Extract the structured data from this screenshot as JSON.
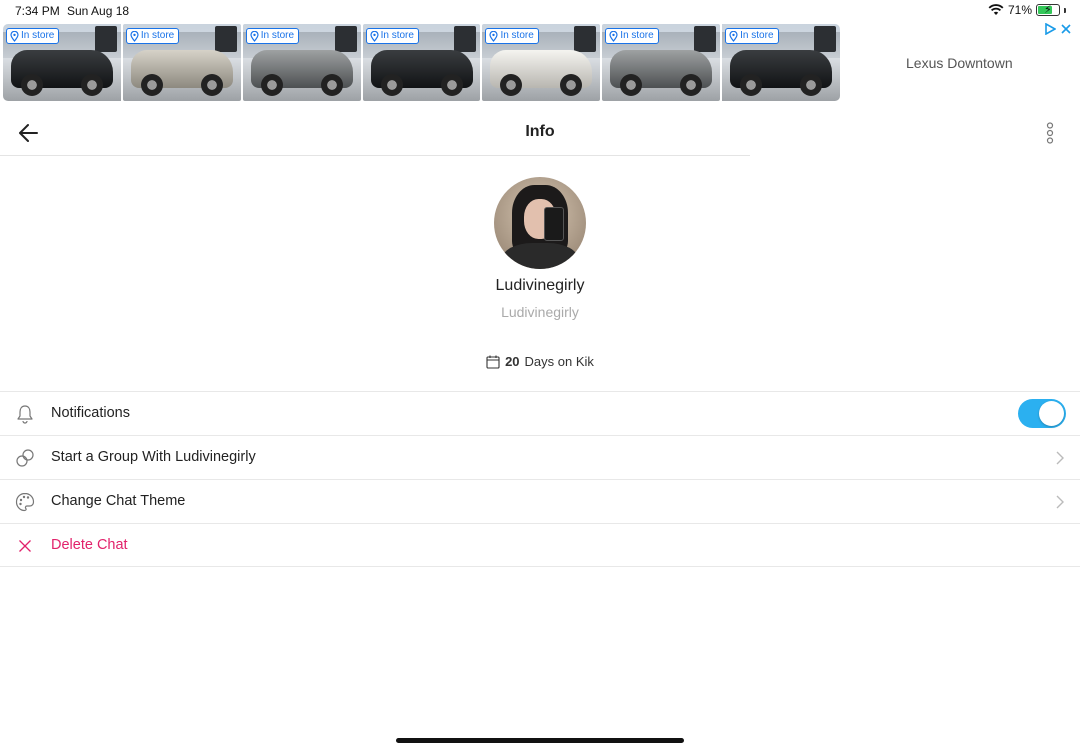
{
  "status_bar": {
    "time": "7:34 PM",
    "date": "Sun Aug 18",
    "battery_percent": "71%",
    "battery_level": 0.71,
    "battery_color": "#33c759"
  },
  "ad": {
    "badge_label": "In store",
    "badge_color": "#1a73e8",
    "advertiser": "Lexus Downtown",
    "card_count": 7,
    "icons": [
      "pin-icon",
      "ad-choices-icon",
      "close-icon"
    ]
  },
  "header": {
    "title": "Info",
    "back_icon": "arrow-left-icon",
    "more_icon": "vertical-dots-icon"
  },
  "profile": {
    "display_name": "Ludivinegirly",
    "username": "Ludivinegirly",
    "days_count": "20",
    "days_suffix": "Days on Kik"
  },
  "settings": {
    "notifications": {
      "label": "Notifications",
      "icon": "bell-icon",
      "enabled": true,
      "toggle_color": "#2bb0f0"
    },
    "start_group": {
      "label": "Start a Group With Ludivinegirly",
      "icon": "group-icon"
    },
    "change_theme": {
      "label": "Change Chat Theme",
      "icon": "palette-icon"
    },
    "delete_chat": {
      "label": "Delete Chat",
      "icon": "x-icon",
      "color": "#e2226b"
    }
  }
}
